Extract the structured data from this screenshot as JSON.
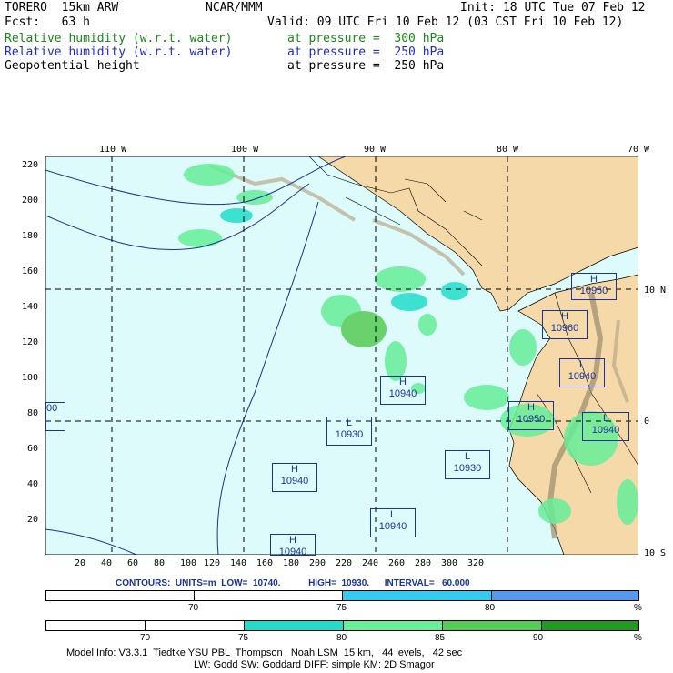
{
  "header": {
    "model": "TORERO  15km ARW",
    "org": "NCAR/MMM",
    "init": "Init: 18 UTC Tue 07 Feb 12",
    "fcst": "Fcst:   63 h",
    "valid": "Valid: 09 UTC Fri 10 Feb 12 (03 CST Fri 10 Feb 12)",
    "fields": [
      {
        "name": "Relative humidity (w.r.t. water)",
        "level": "at pressure =  300 hPa",
        "color": "#1a8a1a"
      },
      {
        "name": "Relative humidity (w.r.t. water)",
        "level": "at pressure =  250 hPa",
        "color": "#1f2bd0"
      },
      {
        "name": "Geopotential height",
        "level": "at pressure =  250 hPa",
        "color": "#000000"
      }
    ]
  },
  "map": {
    "lon_labels": [
      "110 W",
      "100 W",
      "90 W",
      "80 W",
      "70 W"
    ],
    "lat_labels": [
      "10 N",
      "0",
      "10 S"
    ],
    "y_ticks": [
      "220",
      "200",
      "180",
      "160",
      "140",
      "120",
      "100",
      "80",
      "60",
      "40",
      "20"
    ],
    "x_ticks": [
      "20",
      "40",
      "60",
      "80",
      "100",
      "120",
      "140",
      "160",
      "180",
      "200",
      "220",
      "240",
      "260",
      "280",
      "300",
      "320"
    ],
    "centers": [
      {
        "type": "H",
        "value": "10950"
      },
      {
        "type": "H",
        "value": "10960"
      },
      {
        "type": "L",
        "value": "10940"
      },
      {
        "type": "H",
        "value": "10940"
      },
      {
        "type": "H",
        "value": "10950"
      },
      {
        "type": "L",
        "value": "10940"
      },
      {
        "type": "L",
        "value": "10930"
      },
      {
        "type": "L",
        "value": "10930"
      },
      {
        "type": "H",
        "value": "10940"
      },
      {
        "type": "L",
        "value": "10940"
      },
      {
        "type": "H",
        "value": "10940"
      },
      {
        "type": "",
        "value": "00"
      }
    ]
  },
  "contours": "CONTOURS:  UNITS=m  LOW=  10740.           HIGH=  10930.      INTERVAL=   60.000",
  "legend1": {
    "labels": [
      "70",
      "75",
      "80"
    ],
    "unit": "%",
    "colors": [
      "#ffffff",
      "#ffffff",
      "#33ccf0",
      "#5599ee"
    ]
  },
  "legend2": {
    "labels": [
      "70",
      "75",
      "80",
      "85",
      "90"
    ],
    "unit": "%",
    "colors": [
      "#ffffff",
      "#ffffff",
      "#22ddcc",
      "#66ee99",
      "#55cc55",
      "#229922"
    ]
  },
  "footer": {
    "line1": "Model Info: V3.3.1  Tiedtke YSU PBL  Thompson   Noah LSM  15 km,   44 levels,   42 sec",
    "line2": "LW: Godd SW: Goddard DIFF: simple KM: 2D Smagor"
  }
}
